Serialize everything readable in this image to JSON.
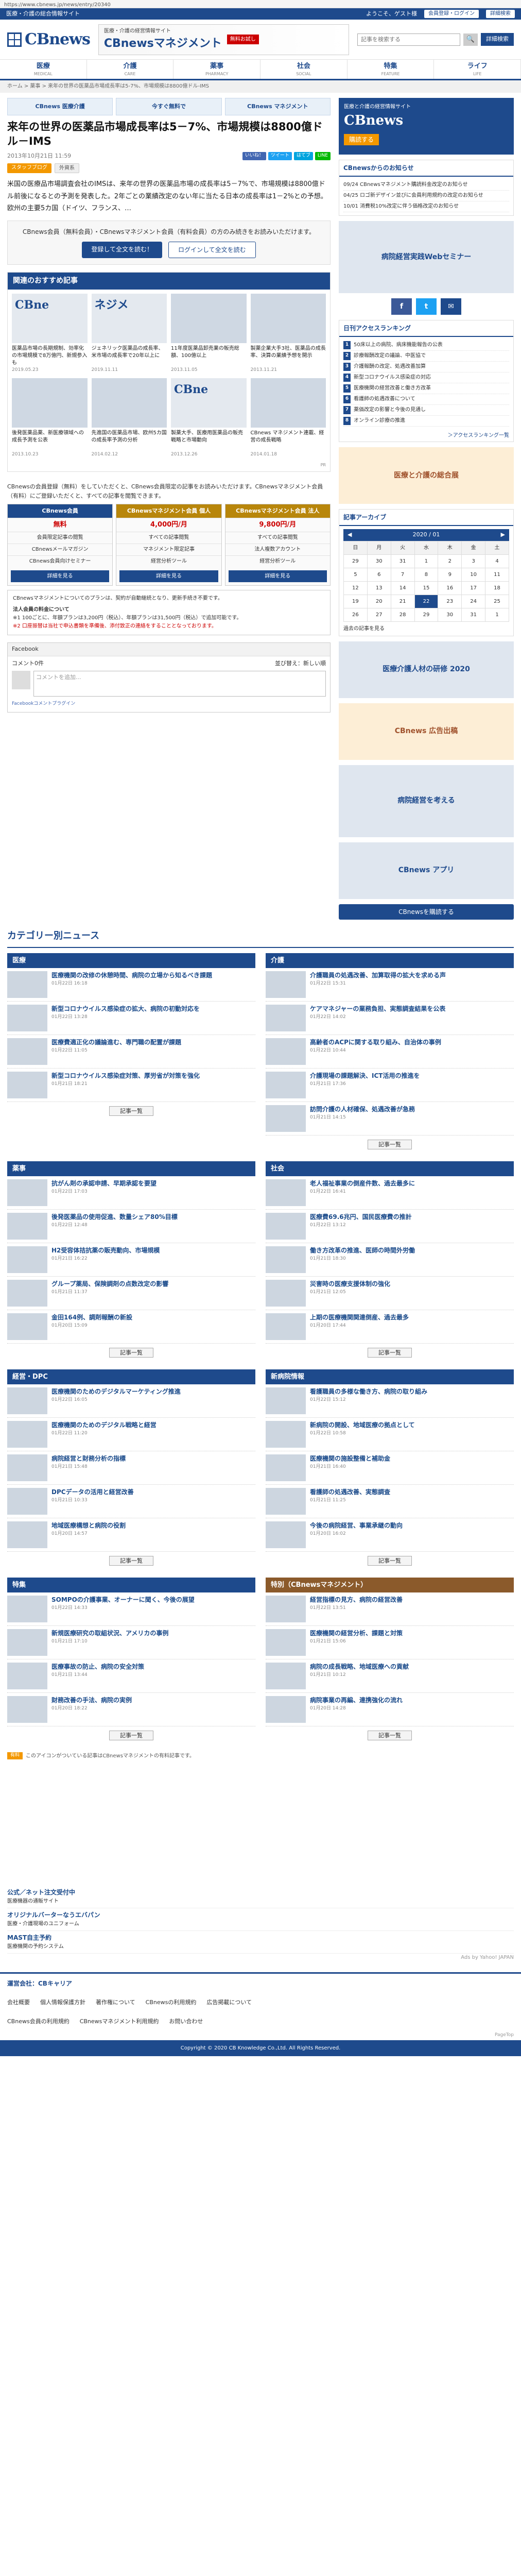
{
  "browser": {
    "url": "https://www.cbnews.jp/news/entry/20340"
  },
  "top": {
    "site": "医療・介護の総合情報サイト",
    "links": [
      "ようこそ、ゲスト様",
      "会員登録・ログイン",
      "詳細検索"
    ]
  },
  "header": {
    "logo": "CBnews",
    "banner_small": "医療・介護の経営情報サイト",
    "banner_main": "CBnewsマネジメント",
    "banner_badge": "無料お試し",
    "search_placeholder": "記事を検索する",
    "search_button": "詳細検索"
  },
  "nav": [
    {
      "ja": "医療",
      "en": "MEDICAL"
    },
    {
      "ja": "介護",
      "en": "CARE"
    },
    {
      "ja": "薬事",
      "en": "PHARMACY"
    },
    {
      "ja": "社会",
      "en": "SOCIAL"
    },
    {
      "ja": "特集",
      "en": "FEATURE"
    },
    {
      "ja": "ライフ",
      "en": "LIFE"
    }
  ],
  "breadcrumb": "ホーム > 薬事 > 来年の世界の医薬品市場成長率は5-7%、市場規模は8800億ドル-IMS",
  "adbar": [
    "CBnews 医療介護",
    "今すぐ無料で",
    "CBnews マネジメント"
  ],
  "article": {
    "title": "来年の世界の医薬品市場成長率は5－7%、市場規模は8800億ドル－IMS",
    "date": "2013年10月21日 11:59",
    "tags": [
      "スタッフブログ",
      "外資系"
    ],
    "social": [
      "いいね！",
      "ツイート",
      "はてブ",
      "LINE"
    ],
    "body": "米国の医療品市場調査会社のIMSは、来年の世界の医薬品市場の成長率は5－7%で、市場規模は8800億ドル前後になるとの予測を発表した。2年ごとの業績改定のない年に当たる日本の成長率は1－2%との予想。欧州の主要5カ国（ドイツ、フランス、…",
    "lock_text": "CBnews会員（無料会員）・CBnewsマネジメント会員（有料会員）の方のみ続きをお読みいただけます。",
    "btn_register": "登録して全文を読む！",
    "btn_login": "ログインして全文を読む"
  },
  "recommend": {
    "heading": "関連のおすすめ記事",
    "items": [
      {
        "title": "医薬品市場の長期規制、効率化の市場規模で8万億円、新規参入も",
        "date": "2019.05.23"
      },
      {
        "title": "ジェネリック医薬品の成長率、米市場の成長率で20年以上に",
        "date": "2019.11.11"
      },
      {
        "title": "11年度医薬品卸売業の販売総額、100億以上",
        "date": "2013.11.05"
      },
      {
        "title": "製薬企業大手3社、医薬品の成長率、決算の業績予想を開示",
        "date": "2013.11.21"
      },
      {
        "title": "後発医薬品薬、新医療領域への成長予測を公表",
        "date": "2013.10.23"
      },
      {
        "title": "先進国の医薬品市場、欧州5カ国の成長率予測の分析",
        "date": "2014.02.12"
      },
      {
        "title": "製薬大手、医療用医薬品の販売戦略と市場動向",
        "date": "2013.12.26"
      },
      {
        "title": "CBnews マネジメント連載、経営の成長戦略",
        "date": "2014.01.18"
      }
    ],
    "pr": "PR"
  },
  "plans": {
    "intro": "CBnewsの会員登録（無料）をしていただくと、CBnews会員限定の記事をお読みいただけます。CBnewsマネジメント会員（有料）にご登録いただくと、すべての記事を閲覧できます。",
    "cols": [
      {
        "name": "CBnews会員",
        "price": "無料",
        "rows": [
          "会員限定記事の閲覧",
          "CBnewsメールマガジン",
          "CBnews会員向けセミナー"
        ],
        "btn": "詳細を見る"
      },
      {
        "name": "CBnewsマネジメント会員 個人",
        "price": "4,000円/月",
        "rows": [
          "すべての記事閲覧",
          "マネジメント限定記事",
          "経営分析ツール"
        ],
        "btn": "詳細を見る"
      },
      {
        "name": "CBnewsマネジメント会員 法人",
        "price": "9,800円/月",
        "rows": [
          "すべての記事閲覧",
          "法人複数アカウント",
          "経営分析ツール"
        ],
        "btn": "詳細を見る"
      }
    ],
    "note": "CBnewsマネジメントについてのプランは、契約が自動継続となり、更新手続き不要です。",
    "corp_title": "法人会員の料金について",
    "corp_text": "※1 100ごとに、年額プランは3,200円（税込）、年額プランは31,500円（税込）で追加可能です。",
    "corp_warn": "※2 口座振替は当社で申込書類を準備後、添付致正の連絡をすることとなっております。"
  },
  "facebook": {
    "label": "Facebook",
    "count": "コメント0件",
    "sort": "並び替え：新しい順",
    "placeholder": "コメントを追加...",
    "plugin": "Facebookコメントプラグイン"
  },
  "right": {
    "ad": {
      "line1": "医療と介護の経営情報サイト",
      "line2": "CBnews",
      "line3": "購読する"
    },
    "notice_head": "CBnewsからのお知らせ",
    "notices": [
      "09/24 CBnewsマネジメント購読料金改定のお知らせ",
      "04/25 ロゴ新デザイン並びに会員利用規約の改定のお知らせ",
      "10/01 消費税10%改定に伴う価格改定のお知らせ"
    ],
    "img1": "病院経営実践Webセミナー",
    "sns": [
      "f",
      "t",
      "✉"
    ],
    "rank_head": "日刊アクセスランキング",
    "ranks": [
      "50床以上の病院、病床機能報告の公表",
      "診療報酬改定の議論、中医協で",
      "介護報酬の改定、処遇改善加算",
      "新型コロナウイルス感染症の対応",
      "医療機関の経営改善と働き方改革",
      "看護師の処遇改善について",
      "薬価改定の影響と今後の見通し",
      "オンライン診療の推進"
    ],
    "rank_more": "＞アクセスランキング一覧",
    "img2": "医療と介護の総合展",
    "cal_head": "記事アーカイブ",
    "cal_month": "2020 / 01",
    "cal_days": [
      "日",
      "月",
      "火",
      "水",
      "木",
      "金",
      "土"
    ],
    "cal_rows": [
      [
        "29",
        "30",
        "31",
        "1",
        "2",
        "3",
        "4"
      ],
      [
        "5",
        "6",
        "7",
        "8",
        "9",
        "10",
        "11"
      ],
      [
        "12",
        "13",
        "14",
        "15",
        "16",
        "17",
        "18"
      ],
      [
        "19",
        "20",
        "21",
        "22",
        "23",
        "24",
        "25"
      ],
      [
        "26",
        "27",
        "28",
        "29",
        "30",
        "31",
        "1"
      ]
    ],
    "cal_sel": "22",
    "cal_archive": "過去の記事を見る",
    "img3": "医療介護人材の研修 2020",
    "img4": "CBnews 広告出稿",
    "img5": "病院経営を考える",
    "img6": "CBnews アプリ",
    "follow": "CBnewsを購読する"
  },
  "categories": {
    "title": "カテゴリー別ニュース",
    "all_label": "記事一覧",
    "blocks": [
      {
        "name": "医療",
        "items": [
          {
            "t": "医療機関の改修の休憩時間、病院の立場から知るべき課題",
            "d": "01月22日 16:18"
          },
          {
            "t": "新型コロナウイルス感染症の拡大、病院の初動対応を",
            "d": "01月22日 13:28"
          },
          {
            "t": "医療費適正化の議論進む、専門職の配置が課題",
            "d": "01月22日 11:05"
          },
          {
            "t": "新型コロナウイルス感染症対策、厚労省が対策を強化",
            "d": "01月21日 18:21"
          }
        ]
      },
      {
        "name": "介護",
        "items": [
          {
            "t": "介護職員の処遇改善、加算取得の拡大を求める声",
            "d": "01月22日 15:31"
          },
          {
            "t": "ケアマネジャーの業務負担、実態調査結果を公表",
            "d": "01月22日 14:02"
          },
          {
            "t": "高齢者のACPに関する取り組み、自治体の事例",
            "d": "01月22日 10:44"
          },
          {
            "t": "介護現場の課題解決、ICT活用の推進を",
            "d": "01月21日 17:36"
          },
          {
            "t": "訪問介護の人材確保、処遇改善が急務",
            "d": "01月21日 14:15"
          }
        ]
      },
      {
        "name": "薬事",
        "items": [
          {
            "t": "抗がん剤の承認申請、早期承認を要望",
            "d": "01月22日 17:03"
          },
          {
            "t": "後発医薬品の使用促進、数量シェア80%目標",
            "d": "01月22日 12:48"
          },
          {
            "t": "H2受容体拮抗薬の販売動向、市場規模",
            "d": "01月21日 16:22"
          },
          {
            "t": "グループ薬局、保険調剤の点数改定の影響",
            "d": "01月21日 11:37"
          },
          {
            "t": "金田164例、調剤報酬の新設",
            "d": "01月20日 15:09"
          }
        ]
      },
      {
        "name": "社会",
        "items": [
          {
            "t": "老人福祉事業の倒産件数、過去最多に",
            "d": "01月22日 16:41"
          },
          {
            "t": "医療費69.6兆円、国民医療費の推計",
            "d": "01月22日 13:12"
          },
          {
            "t": "働き方改革の推進、医師の時間外労働",
            "d": "01月21日 18:30"
          },
          {
            "t": "災害時の医療支援体制の強化",
            "d": "01月21日 12:05"
          },
          {
            "t": "上期の医療機関関連倒産、過去最多",
            "d": "01月20日 17:44"
          }
        ]
      },
      {
        "name": "経営・DPC",
        "items": [
          {
            "t": "医療機関のためのデジタルマーケティング推進",
            "d": "01月22日 16:05"
          },
          {
            "t": "医療機関のためのデジタル戦略と経営",
            "d": "01月22日 11:20"
          },
          {
            "t": "病院経営と財務分析の指標",
            "d": "01月21日 15:48"
          },
          {
            "t": "DPCデータの活用と経営改善",
            "d": "01月21日 10:33"
          },
          {
            "t": "地域医療構想と病院の役割",
            "d": "01月20日 14:57"
          }
        ]
      },
      {
        "name": "新病院情報",
        "items": [
          {
            "t": "看護職員の多様な働き方、病院の取り組み",
            "d": "01月22日 15:12"
          },
          {
            "t": "新病院の開設、地域医療の拠点として",
            "d": "01月22日 10:58"
          },
          {
            "t": "医療機関の施設整備と補助金",
            "d": "01月21日 16:40"
          },
          {
            "t": "看護師の処遇改善、実態調査",
            "d": "01月21日 11:25"
          },
          {
            "t": "今後の病院経営、事業承継の動向",
            "d": "01月20日 16:02"
          }
        ]
      },
      {
        "name": "特集",
        "items": [
          {
            "t": "SOMPOの介護事業、オーナーに聞く、今後の展望",
            "d": "01月22日 14:33"
          },
          {
            "t": "新規医療研究の取組状況、アメリカの事例",
            "d": "01月21日 17:10"
          },
          {
            "t": "医療事故の防止、病院の安全対策",
            "d": "01月21日 13:44"
          },
          {
            "t": "財務改善の手法、病院の実例",
            "d": "01月20日 18:22"
          }
        ]
      },
      {
        "name": "特別（CBnewsマネジメント）",
        "m": true,
        "items": [
          {
            "t": "経営指標の見方、病院の経営改善",
            "d": "01月22日 13:51"
          },
          {
            "t": "医療機関の経営分析、課題と対策",
            "d": "01月21日 15:06"
          },
          {
            "t": "病院の成長戦略、地域医療への貢献",
            "d": "01月21日 10:12"
          },
          {
            "t": "病院事業の再編、連携強化の流れ",
            "d": "01月20日 14:28"
          }
        ]
      }
    ],
    "legend": "このアイコンがついている記事はCBnewsマネジメントの有料記事です。",
    "legend_key": "有料"
  },
  "ads": [
    {
      "t": "公式／ネット注文受付中",
      "d": "医療機器の通販サイト"
    },
    {
      "t": "オリジナルバーターなうエバパン",
      "d": "医療・介護現場のユニフォーム"
    },
    {
      "t": "MAST自主予約",
      "d": "医療機関の予約システム"
    }
  ],
  "ads_by": "Ads by Yahoo! JAPAN",
  "footer": {
    "head": "運営会社：CBキャリア",
    "links": [
      "会社概要",
      "個人情報保護方針",
      "著作権について",
      "CBnewsの利用規約",
      "広告掲載について"
    ],
    "links2": [
      "CBnews会員の利用規約",
      "CBnewsマネジメント利用規約",
      "お問い合わせ"
    ],
    "copyright": "Copyright © 2020 CB Knowledge Co.,Ltd. All Rights Reserved."
  },
  "pv": "PageTop"
}
